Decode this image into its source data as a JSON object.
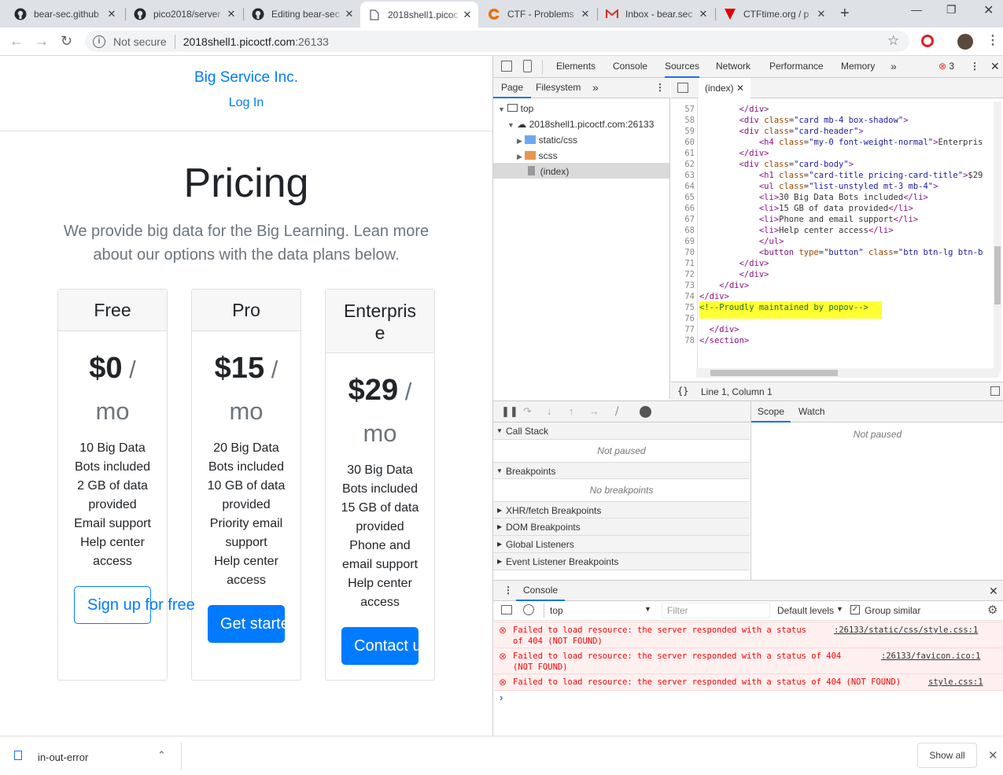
{
  "browser": {
    "tabs": [
      {
        "title": "bear-sec.github",
        "icon": "github-icon"
      },
      {
        "title": "pico2018/server",
        "icon": "github-icon"
      },
      {
        "title": "Editing bear-sec",
        "icon": "github-icon"
      },
      {
        "title": "2018shell1.picoc",
        "icon": "document-icon"
      },
      {
        "title": "CTF - Problems",
        "icon": "ctf-icon"
      },
      {
        "title": "Inbox - bear.sec",
        "icon": "gmail-icon"
      },
      {
        "title": "CTFtime.org / p",
        "icon": "ctftime-icon"
      }
    ],
    "security_label": "Not secure",
    "url_host": "2018shell1.picoctf.com",
    "url_port": ":26133"
  },
  "site": {
    "brand": "Big Service Inc.",
    "login": "Log In",
    "heading": "Pricing",
    "lead_line1": "We provide big data for the Big Learning. Lean more",
    "lead_line2": "about our options with the data plans below."
  },
  "plans": [
    {
      "name": "Free",
      "price": "$0",
      "per": " / ",
      "mo": "mo",
      "features": [
        "10 Big Data",
        "Bots included",
        "2 GB of data",
        "provided",
        "Email support",
        "Help center",
        "access"
      ],
      "button": "Sign up for free"
    },
    {
      "name": "Pro",
      "price": "$15",
      "per": " / ",
      "mo": "mo",
      "features": [
        "20 Big Data",
        "Bots included",
        "10 GB of data",
        "provided",
        "Priority email",
        "support",
        "Help center",
        "access"
      ],
      "button": "Get started"
    },
    {
      "name_line1": "Enterpris",
      "name_line2": "e",
      "price": "$29",
      "per": " / ",
      "mo": "mo",
      "features": [
        "30 Big Data",
        "Bots included",
        "15 GB of data",
        "provided",
        "Phone and",
        "email support",
        "Help center",
        "access"
      ],
      "button": "Contact us"
    }
  ],
  "devtools": {
    "tabs": [
      "Elements",
      "Console",
      "Sources",
      "Network",
      "Performance",
      "Memory"
    ],
    "error_count": "3",
    "nav_tabs": [
      "Page",
      "Filesystem"
    ],
    "tree": {
      "top": "top",
      "host": "2018shell1.picoctf.com:26133",
      "folder1": "static/css",
      "folder2": "scss",
      "file": "(index)"
    },
    "editor_tab": "(index)",
    "line_numbers": [
      "57",
      "58",
      "59",
      "60",
      "61",
      "62",
      "63",
      "64",
      "65",
      "66",
      "67",
      "68",
      "69",
      "70",
      "71",
      "72",
      "73",
      "74",
      "75",
      "76",
      "77",
      "78"
    ],
    "status": "Line 1, Column 1",
    "call_stack": "Call Stack",
    "not_paused": "Not paused",
    "breakpoints": "Breakpoints",
    "no_breakpoints": "No breakpoints",
    "xhr": "XHR/fetch Breakpoints",
    "dom": "DOM Breakpoints",
    "global": "Global Listeners",
    "event": "Event Listener Breakpoints",
    "scope": "Scope",
    "watch": "Watch",
    "scope_not_paused": "Not paused",
    "console_title": "Console",
    "context": "top",
    "filter_placeholder": "Filter",
    "levels": "Default levels",
    "group_similar": "Group similar",
    "errors": [
      {
        "line1": "Failed to load resource: the server responded with a status",
        "line2": "of 404 (NOT FOUND)",
        "source": ":26133/static/css/style.css:1"
      },
      {
        "line1": "Failed to load resource: the server responded with a status of 404",
        "line2": "(NOT FOUND)",
        "source": ":26133/favicon.ico:1"
      },
      {
        "line1": "Failed to load resource: the server responded with a status of 404 (NOT FOUND)",
        "line2": "",
        "source": "style.css:1"
      }
    ]
  },
  "download": {
    "filename": "in-out-error",
    "show_all": "Show all"
  }
}
